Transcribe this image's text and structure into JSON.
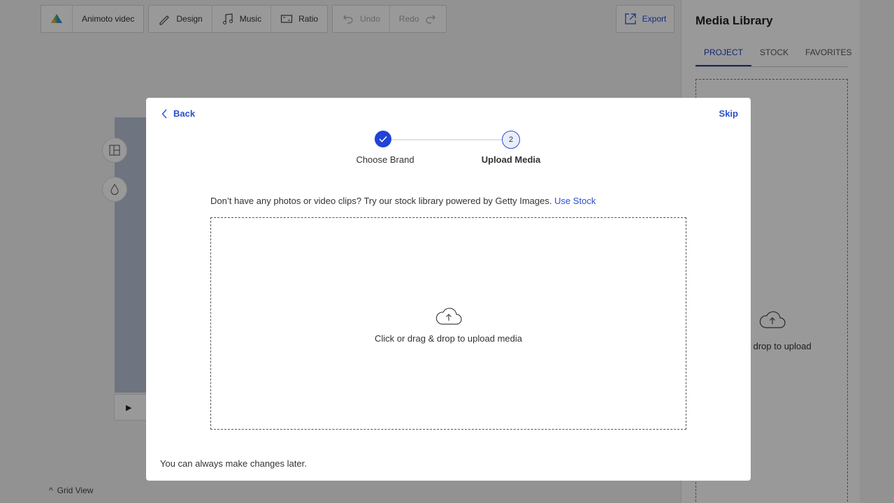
{
  "toolbar": {
    "project_name": "Animoto videc",
    "design_label": "Design",
    "music_label": "Music",
    "ratio_label": "Ratio",
    "undo_label": "Undo",
    "redo_label": "Redo",
    "export_label": "Export"
  },
  "editor": {
    "grid_view_label": "Grid View"
  },
  "media_library": {
    "title": "Media Library",
    "tabs": [
      {
        "label": "PROJECT",
        "active": true
      },
      {
        "label": "STOCK",
        "active": false
      },
      {
        "label": "FAVORITES",
        "active": false
      }
    ],
    "drop_text": "ag & drop to upload"
  },
  "modal": {
    "back_label": "Back",
    "skip_label": "Skip",
    "steps": [
      {
        "number": "1",
        "label": "Choose Brand",
        "state": "done"
      },
      {
        "number": "2",
        "label": "Upload Media",
        "state": "current"
      }
    ],
    "stock_prompt": "Don’t have any photos or video clips? Try our stock library powered by Getty Images.",
    "stock_link": "Use Stock",
    "dropzone_text": "Click or drag & drop to upload media",
    "footer_note": "You can always make changes later."
  },
  "colors": {
    "accent": "#2a4fd0",
    "step_done": "#2043d8",
    "overlay": "rgba(0,0,0,0.4)"
  }
}
